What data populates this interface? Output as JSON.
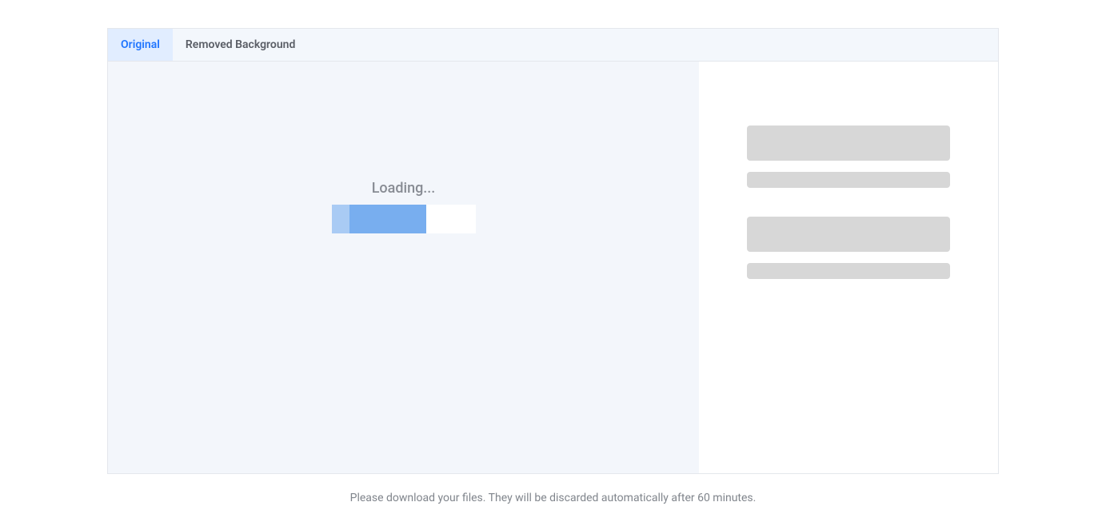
{
  "tabs": {
    "original": "Original",
    "removedBackground": "Removed Background"
  },
  "loading": {
    "text": "Loading..."
  },
  "footer": {
    "message": "Please download your files. They will be discarded automatically after 60 minutes."
  }
}
